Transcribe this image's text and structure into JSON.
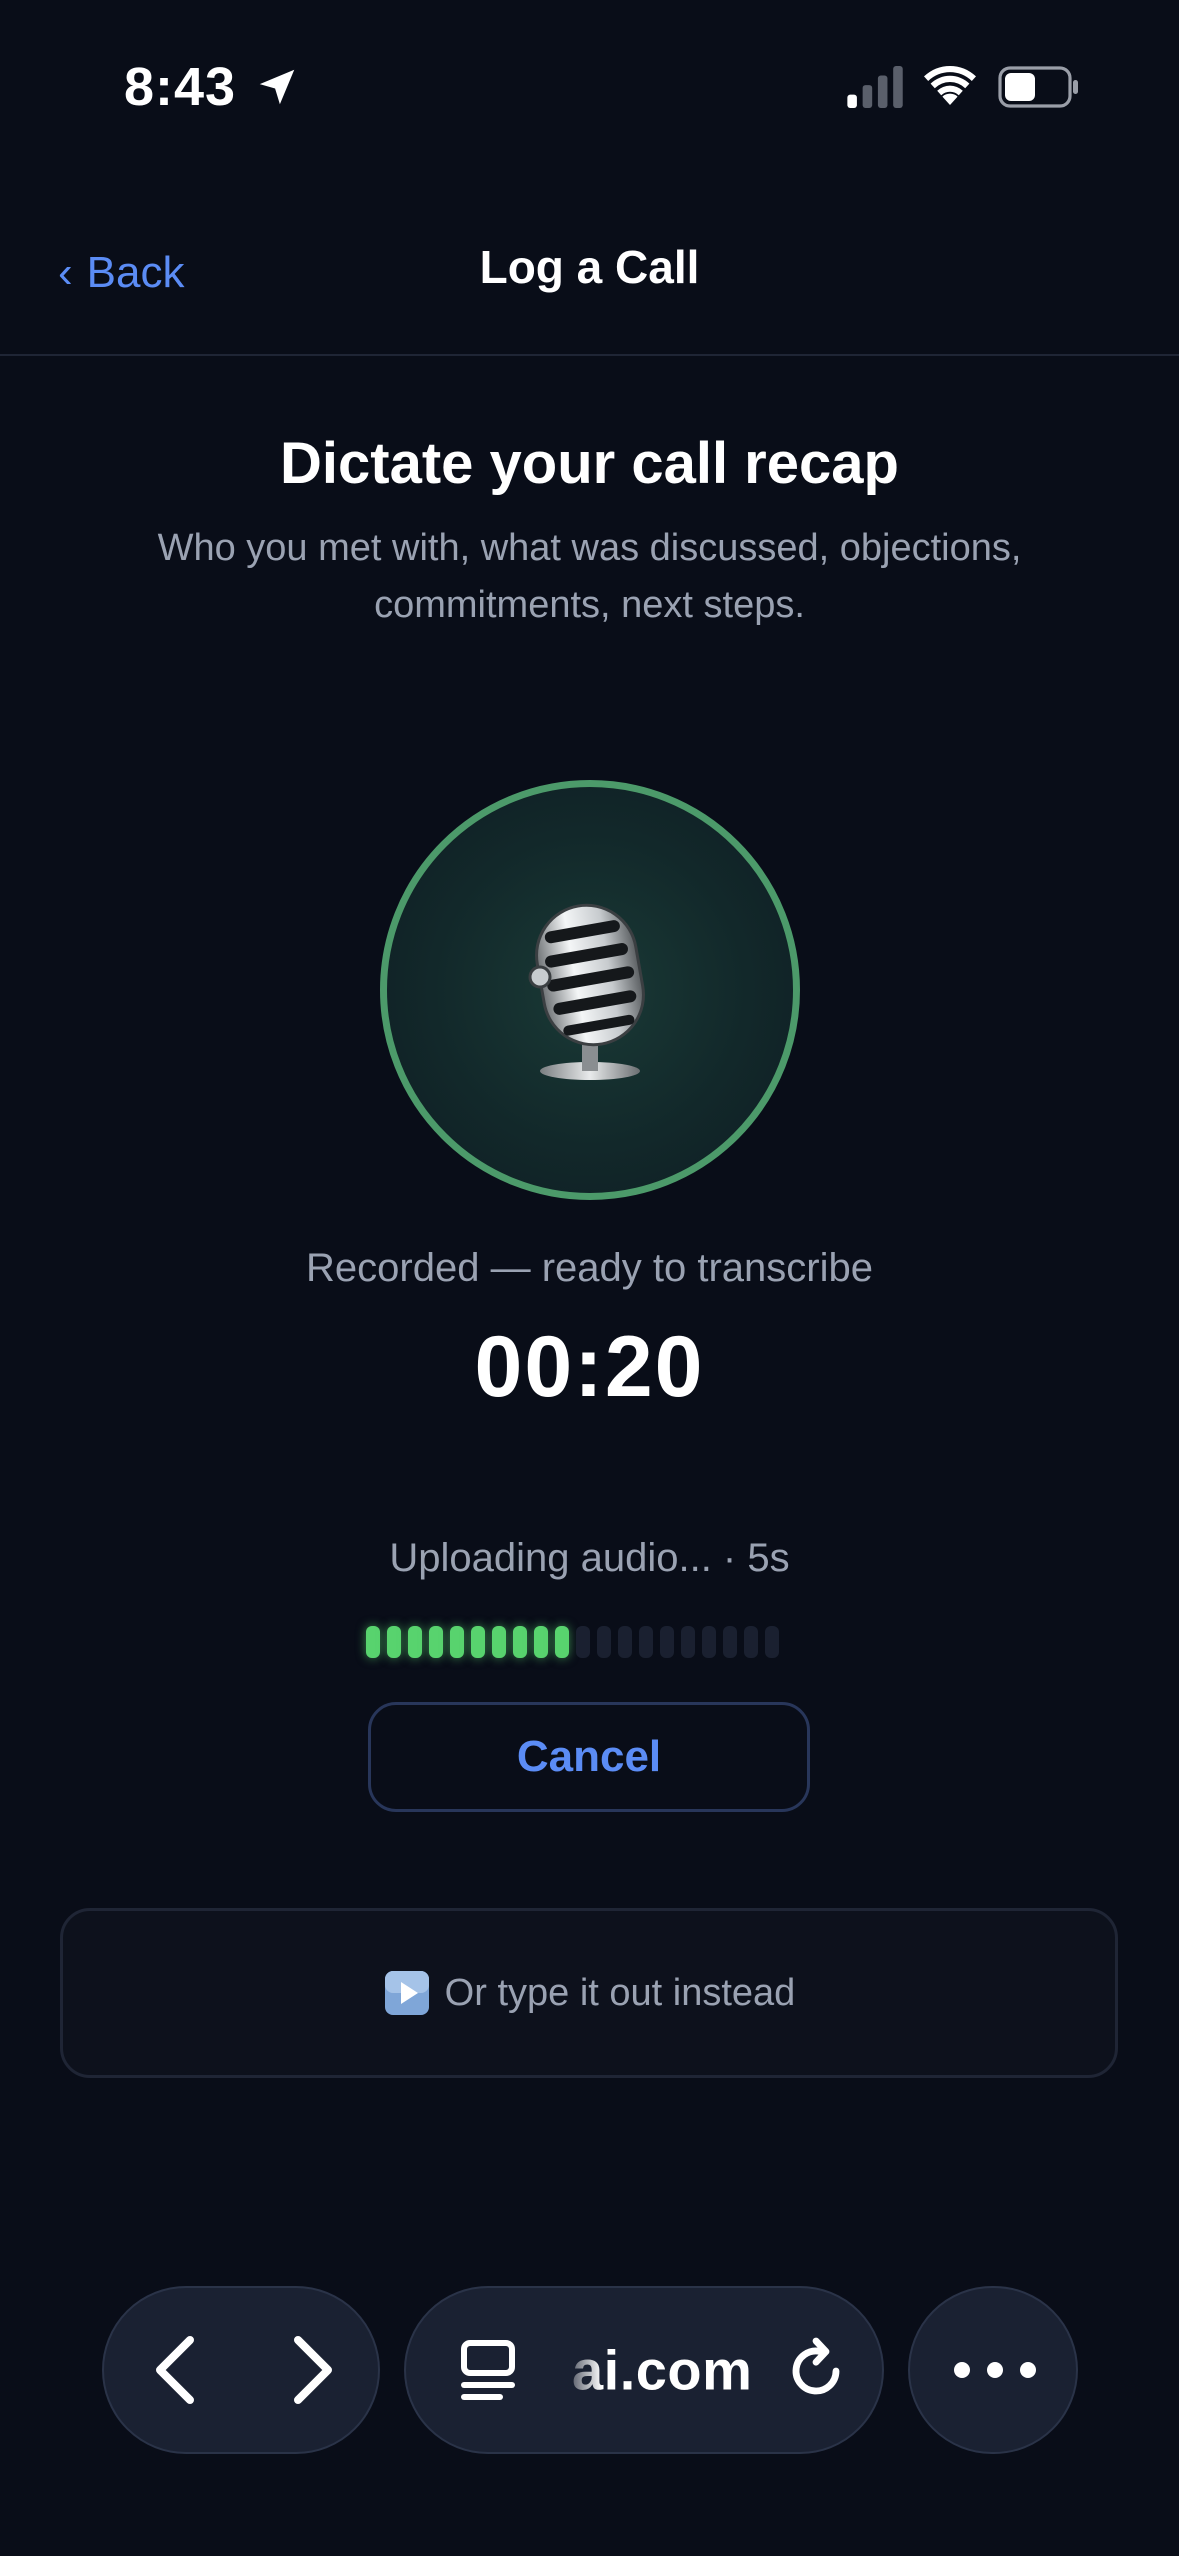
{
  "status_bar": {
    "time": "8:43",
    "icons": [
      "location-arrow-icon",
      "cellular-signal-icon",
      "wifi-icon",
      "battery-icon"
    ]
  },
  "nav": {
    "back_chevron": "‹",
    "back_label": "Back",
    "title": "Log a Call"
  },
  "header": {
    "title": "Dictate your call recap",
    "subtitle": "Who you met with, what was discussed, objections, commitments, next steps."
  },
  "recorder": {
    "icon": "microphone-icon",
    "status": "Recorded — ready to transcribe",
    "duration": "00:20",
    "ring_color": "#4c9a6a"
  },
  "upload": {
    "status": "Uploading audio... · 5s",
    "progress_segments_total": 20,
    "progress_segments_filled": 10,
    "progress_color": "#58d36e",
    "cancel_label": "Cancel"
  },
  "alternative": {
    "icon": "play-button-icon",
    "label": "Or type it out instead"
  },
  "browser_toolbar": {
    "url": "ai.com",
    "icons": [
      "back-arrow-icon",
      "forward-arrow-icon",
      "tabs-icon",
      "reload-icon",
      "more-icon"
    ]
  },
  "colors": {
    "background": "#090d18",
    "accent": "#5b8cf5",
    "muted_text": "#9aa2b2"
  }
}
